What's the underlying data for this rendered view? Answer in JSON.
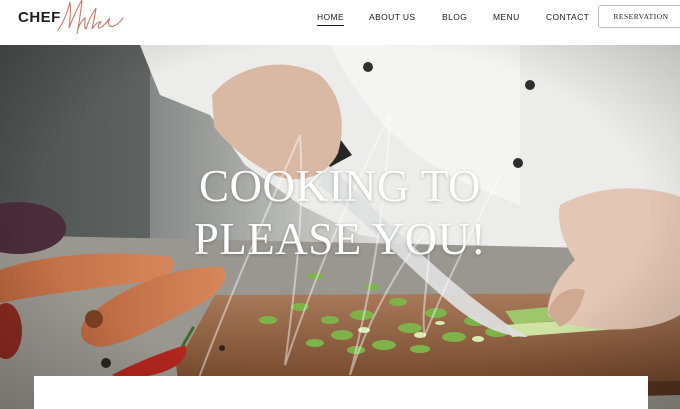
{
  "header": {
    "logo": {
      "text": "CHEF",
      "script": "Mike"
    },
    "nav": [
      {
        "label": "HOME",
        "active": true
      },
      {
        "label": "ABOUT US",
        "active": false
      },
      {
        "label": "BLOG",
        "active": false
      },
      {
        "label": "MENU",
        "active": false
      },
      {
        "label": "CONTACT",
        "active": false
      }
    ],
    "reservation_label": "RESERVATION"
  },
  "hero": {
    "title_line1": "COOKING TO",
    "title_line2": "PLEASE YOU!"
  },
  "colors": {
    "accent": "#c77b66",
    "text": "#1e1e1e",
    "board": "#8a5a3c"
  }
}
